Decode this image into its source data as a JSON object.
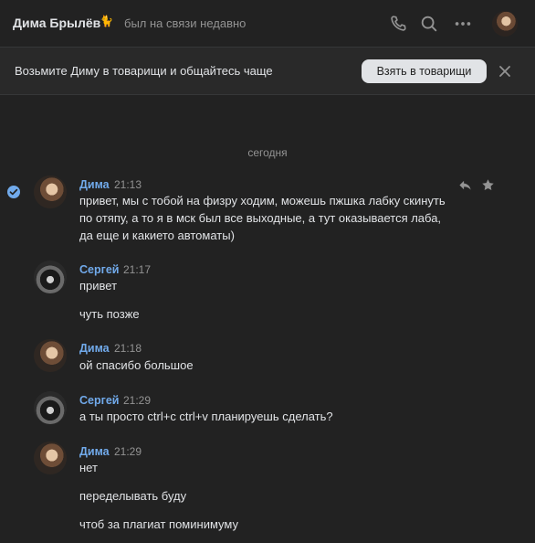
{
  "header": {
    "name": "Дима Брылёв",
    "emoji": "🐈",
    "status": "был на связи недавно",
    "icons": [
      "phone-icon",
      "search-icon",
      "more-icon"
    ]
  },
  "banner": {
    "text": "Возьмите Диму в товарищи и общайтесь чаще",
    "button": "Взять в товарищи",
    "close_icon": "close-icon"
  },
  "date_separator": "сегодня",
  "messages": [
    {
      "author": "Дима",
      "time": "21:13",
      "lines": [
        "привет, мы с тобой на физру ходим, можешь пжшка лабку скинуть",
        "по отяпу, а то я в мск был все выходные, а тут оказывается лаба,",
        "да еще и какието автоматы)"
      ]
    },
    {
      "author": "Сергей",
      "time": "21:17",
      "lines": [
        "привет",
        "чуть позже"
      ]
    },
    {
      "author": "Дима",
      "time": "21:18",
      "lines": [
        "ой спасибо большое"
      ]
    },
    {
      "author": "Сергей",
      "time": "21:29",
      "lines": [
        "а ты просто ctrl+c ctrl+v планируешь сделать?"
      ]
    },
    {
      "author": "Дима",
      "time": "21:29",
      "lines": [
        "нет",
        "переделывать буду",
        "чтоб за плагиат поминимуму"
      ]
    }
  ],
  "colors": {
    "background": "#222222",
    "accent": "#71aaeb",
    "text": "#e1e3e6",
    "secondary": "#939393"
  }
}
